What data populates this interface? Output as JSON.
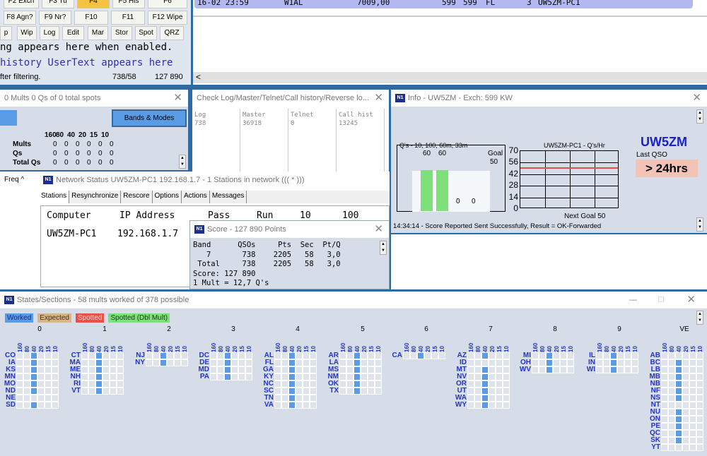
{
  "entry": {
    "buttons_row1": [
      "F2 Exch",
      "F3 Tu",
      "F4",
      "F5 His",
      "F6"
    ],
    "buttons_row2": [
      "F8 Agn?",
      "F9 Nr?",
      "F10",
      "F11",
      "F12 Wipe"
    ],
    "buttons_row3": [
      "p",
      "Wip",
      "Log",
      "Edit",
      "Mar",
      "Stor",
      "Spot",
      "QRZ"
    ],
    "line1": "ng appears here when enabled.",
    "line2": "history UserText appears here",
    "status_left": "fter filtering.",
    "status_qsos": "738/58",
    "status_score": "127 890",
    "active_button_color": "#f5c242"
  },
  "log": {
    "row": [
      "16-02 23:59",
      "W1AL",
      "7009,00",
      "599",
      "599",
      "FL",
      "3",
      "UW5ZM-PC1"
    ]
  },
  "multipliers": {
    "title": "0 Mults 0 Qs of 0 total spots",
    "bands_button": "Bands & Modes",
    "bands": [
      "160",
      "80",
      "40",
      "20",
      "15",
      "10"
    ],
    "rows": [
      {
        "label": "Mults",
        "values": [
          "0",
          "0",
          "0",
          "0",
          "0",
          "0"
        ]
      },
      {
        "label": "Qs",
        "values": [
          "0",
          "0",
          "0",
          "0",
          "0",
          "0"
        ]
      },
      {
        "label": "Total Qs",
        "values": [
          "0",
          "0",
          "0",
          "0",
          "0",
          "0"
        ]
      }
    ]
  },
  "checklog": {
    "title": "Check Log/Master/Telnet/Call history/Reverse lo...",
    "cols": [
      {
        "h": "Log",
        "v": "738"
      },
      {
        "h": "Master",
        "v": "36918"
      },
      {
        "h": "Telnet",
        "v": "0"
      },
      {
        "h": "Call hist",
        "v": "13245"
      }
    ]
  },
  "info": {
    "title": "Info - UW5ZM - Exch: 599 KW",
    "rate_title": "Q's - 10, 100, 60m, 33m",
    "bars": [
      60,
      60,
      0,
      0
    ],
    "goal_label": "Goal",
    "goal": "50",
    "hr_title": "UW5ZM-PC1 - Q's/Hr",
    "hr_ticks": [
      "70",
      "56",
      "42",
      "28",
      "14",
      "0"
    ],
    "next_goal": "Next Goal 50",
    "call": "UW5ZM",
    "last_qso_label": "Last QSO",
    "last_qso": "> 24hrs",
    "status": "14:34:14 - Score Reported Sent Successfully, Result = OK-Forwarded"
  },
  "freq_label": "Freq ^",
  "network": {
    "title": "Network Status UW5ZM-PC1 192.168.1.7 - 1 Stations in network  ((( * )))",
    "tabs": [
      "Stations",
      "Resynchronize",
      "Rescore",
      "Options",
      "Actions",
      "Messages"
    ],
    "headers": [
      "Computer",
      "IP Address",
      "Pass",
      "Run",
      "10",
      "100"
    ],
    "row": [
      "UW5ZM-PC1",
      "192.168.1.7"
    ]
  },
  "score": {
    "title": "Score - 127 890 Points",
    "lines": [
      "Band      QSOs     Pts  Sec  Pt/Q",
      "   7       738    2205   58   3,0",
      " Total     738    2205   58   3,0",
      "Score: 127 890",
      "1 Mult = 12,7 Q's"
    ]
  },
  "states": {
    "title": "States/Sections - 58 mults worked of 378 possible",
    "legend": [
      {
        "label": "Worked",
        "color": "#5a9be6",
        "text": "#1a2a80"
      },
      {
        "label": "Expected",
        "color": "#d7b48a",
        "text": "#4a3010"
      },
      {
        "label": "Spotted",
        "color": "#e8504a",
        "text": "#ffd0d0"
      },
      {
        "label": "Spotted (Dbl Mult)",
        "color": "#7ee07a",
        "text": "#104010"
      }
    ],
    "bands": [
      "160",
      "80",
      "40",
      "20",
      "15",
      "10"
    ],
    "districts": [
      {
        "name": "0",
        "states": [
          [
            "CO",
            1
          ],
          [
            "IA",
            1
          ],
          [
            "KS",
            1
          ],
          [
            "MN",
            1
          ],
          [
            "MO",
            1
          ],
          [
            "ND",
            1
          ],
          [
            "NE",
            0
          ],
          [
            "SD",
            1
          ]
        ]
      },
      {
        "name": "1",
        "states": [
          [
            "CT",
            1
          ],
          [
            "MA",
            1
          ],
          [
            "ME",
            1
          ],
          [
            "NH",
            1
          ],
          [
            "RI",
            1
          ],
          [
            "VT",
            1
          ]
        ]
      },
      {
        "name": "2",
        "states": [
          [
            "NJ",
            1
          ],
          [
            "NY",
            1
          ]
        ]
      },
      {
        "name": "3",
        "states": [
          [
            "DC",
            1
          ],
          [
            "DE",
            1
          ],
          [
            "MD",
            1
          ],
          [
            "PA",
            1
          ]
        ]
      },
      {
        "name": "4",
        "states": [
          [
            "AL",
            1
          ],
          [
            "FL",
            1
          ],
          [
            "GA",
            1
          ],
          [
            "KY",
            1
          ],
          [
            "NC",
            1
          ],
          [
            "SC",
            1
          ],
          [
            "TN",
            1
          ],
          [
            "VA",
            1
          ]
        ]
      },
      {
        "name": "5",
        "states": [
          [
            "AR",
            1
          ],
          [
            "LA",
            1
          ],
          [
            "MS",
            1
          ],
          [
            "NM",
            1
          ],
          [
            "OK",
            1
          ],
          [
            "TX",
            1
          ]
        ]
      },
      {
        "name": "6",
        "states": [
          [
            "CA",
            1
          ]
        ]
      },
      {
        "name": "7",
        "states": [
          [
            "AZ",
            1
          ],
          [
            "ID",
            0
          ],
          [
            "MT",
            1
          ],
          [
            "NV",
            1
          ],
          [
            "OR",
            1
          ],
          [
            "UT",
            1
          ],
          [
            "WA",
            1
          ],
          [
            "WY",
            1
          ]
        ]
      },
      {
        "name": "8",
        "states": [
          [
            "MI",
            1
          ],
          [
            "OH",
            1
          ],
          [
            "WV",
            1
          ]
        ]
      },
      {
        "name": "9",
        "states": [
          [
            "IL",
            1
          ],
          [
            "IN",
            1
          ],
          [
            "WI",
            1
          ]
        ]
      },
      {
        "name": "VE",
        "states": [
          [
            "AB",
            0
          ],
          [
            "BC",
            1
          ],
          [
            "LB",
            1
          ],
          [
            "MB",
            1
          ],
          [
            "NB",
            1
          ],
          [
            "NF",
            1
          ],
          [
            "NS",
            1
          ],
          [
            "NT",
            0
          ],
          [
            "NU",
            1
          ],
          [
            "ON",
            1
          ],
          [
            "PE",
            1
          ],
          [
            "QC",
            1
          ],
          [
            "SK",
            1
          ],
          [
            "YT",
            0
          ]
        ]
      }
    ],
    "worked_band": "40"
  }
}
